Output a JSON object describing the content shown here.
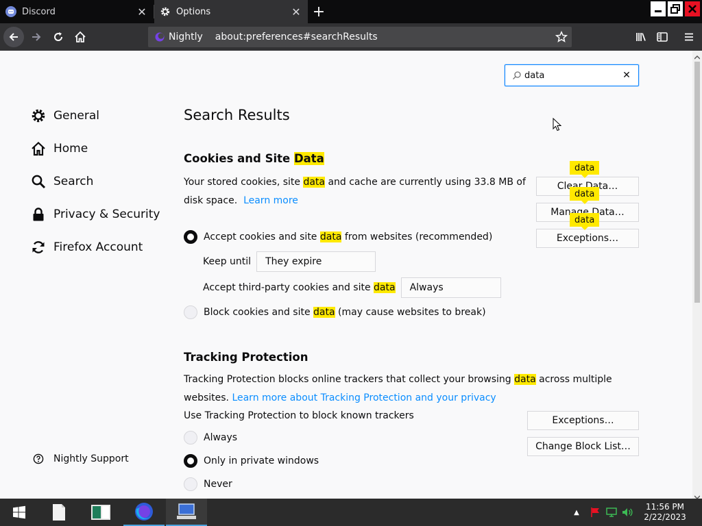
{
  "tabs": [
    {
      "title": "Discord",
      "icon": "discord-icon",
      "active": false
    },
    {
      "title": "Options",
      "icon": "gear-icon",
      "active": true
    }
  ],
  "urlbar": {
    "identity_label": "Nightly",
    "url": "about:preferences#searchResults"
  },
  "search": {
    "value": "data",
    "placeholder": ""
  },
  "nav": {
    "items": [
      {
        "label": "General",
        "icon": "gear-icon"
      },
      {
        "label": "Home",
        "icon": "home-icon"
      },
      {
        "label": "Search",
        "icon": "search-icon"
      },
      {
        "label": "Privacy & Security",
        "icon": "lock-icon"
      },
      {
        "label": "Firefox Account",
        "icon": "sync-icon"
      }
    ],
    "support_label": "Nightly Support"
  },
  "results": {
    "title": "Search Results",
    "highlight_term": "data",
    "cookies": {
      "title_pre": "Cookies and Site ",
      "title_hl": "Data",
      "desc_1": "Your stored cookies, site ",
      "desc_hl": "data",
      "desc_2": " and cache are currently using 33.8 MB of disk space.",
      "learn_more": "Learn more",
      "accept_pre": "Accept cookies and site ",
      "accept_hl": "data",
      "accept_post": " from websites (recommended)",
      "keep_until_label": "Keep until",
      "keep_until_value": "They expire",
      "third_party_pre": "Accept third-party cookies and site ",
      "third_party_hl": "data",
      "third_party_value": "Always",
      "block_pre": "Block cookies and site ",
      "block_hl": "data",
      "block_post": " (may cause websites to break)",
      "clear_btn": "Clear Data…",
      "manage_btn": "Manage Data…",
      "exceptions_btn": "Exceptions…",
      "tooltip": "data"
    },
    "tracking": {
      "title": "Tracking Protection",
      "desc_1": "Tracking Protection blocks online trackers that collect your browsing ",
      "desc_hl": "data",
      "desc_2": " across multiple websites. ",
      "learn_more": "Learn more about Tracking Protection and your privacy",
      "use_label": "Use Tracking Protection to block known trackers",
      "options": [
        "Always",
        "Only in private windows",
        "Never"
      ],
      "selected": 1,
      "exceptions_btn": "Exceptions…",
      "change_block_btn": "Change Block List…"
    }
  },
  "taskbar": {
    "time": "11:56 PM",
    "date": "2/22/2023"
  },
  "colors": {
    "highlight": "#ffe900",
    "link": "#0a8dff",
    "accent": "#0a84ff",
    "chrome_dark": "#0c0c0d",
    "toolbar": "#323234"
  }
}
